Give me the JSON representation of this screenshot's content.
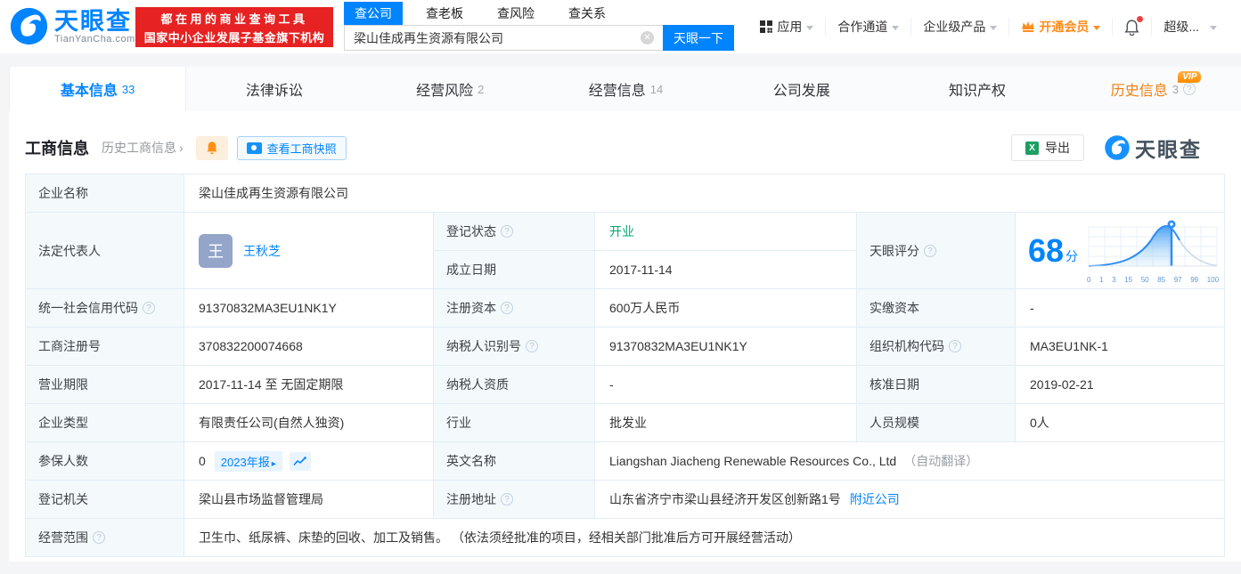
{
  "brand": {
    "name": "天眼查",
    "domain": "TianYanCha.com",
    "primary_color": "#0084ff",
    "promo_line1": "都在用的商业查询工具",
    "promo_line2": "国家中小企业发展子基金旗下机构"
  },
  "search": {
    "tabs": [
      {
        "label": "查公司"
      },
      {
        "label": "查老板"
      },
      {
        "label": "查风险"
      },
      {
        "label": "查关系"
      }
    ],
    "value": "梁山佳成再生资源有限公司",
    "button_label": "天眼一下"
  },
  "top_nav": {
    "apps": "应用",
    "partner": "合作通道",
    "enterprise": "企业级产品",
    "vip": "开通会员",
    "super": "超级..."
  },
  "page_tabs": [
    {
      "label": "基本信息",
      "count": "33"
    },
    {
      "label": "法律诉讼",
      "count": ""
    },
    {
      "label": "经营风险",
      "count": "2"
    },
    {
      "label": "经营信息",
      "count": "14"
    },
    {
      "label": "公司发展",
      "count": ""
    },
    {
      "label": "知识产权",
      "count": ""
    },
    {
      "label": "历史信息",
      "count": "3",
      "vip_badge": "VIP"
    }
  ],
  "section": {
    "title": "工商信息",
    "history_link": "历史工商信息",
    "snapshot_button": "查看工商快照",
    "export_button": "导出",
    "watermark_brand": "天眼查"
  },
  "table": {
    "company_name": {
      "label": "企业名称",
      "value": "梁山佳成再生资源有限公司"
    },
    "legal_rep": {
      "label": "法定代表人",
      "avatar_char": "王",
      "name": "王秋芝"
    },
    "reg_status": {
      "label": "登记状态",
      "value": "开业",
      "color": "#00a870"
    },
    "est_date": {
      "label": "成立日期",
      "value": "2017-11-14"
    },
    "score": {
      "label": "天眼评分",
      "value": "68",
      "unit": "分"
    },
    "credit_code": {
      "label": "统一社会信用代码",
      "value": "91370832MA3EU1NK1Y"
    },
    "reg_capital": {
      "label": "注册资本",
      "value": "600万人民币"
    },
    "paid_capital": {
      "label": "实缴资本",
      "value": "-"
    },
    "reg_number": {
      "label": "工商注册号",
      "value": "370832200074668"
    },
    "taxpayer_id": {
      "label": "纳税人识别号",
      "value": "91370832MA3EU1NK1Y"
    },
    "org_code": {
      "label": "组织机构代码",
      "value": "MA3EU1NK-1"
    },
    "business_term": {
      "label": "营业期限",
      "value": "2017-11-14 至 无固定期限"
    },
    "taxpayer_quality": {
      "label": "纳税人资质",
      "value": "-"
    },
    "approval_date": {
      "label": "核准日期",
      "value": "2019-02-21"
    },
    "company_type": {
      "label": "企业类型",
      "value": "有限责任公司(自然人独资)"
    },
    "industry": {
      "label": "行业",
      "value": "批发业"
    },
    "staff_size": {
      "label": "人员规模",
      "value": "0人"
    },
    "insured_count": {
      "label": "参保人数",
      "value": "0",
      "report_badge": "2023年报"
    },
    "english_name": {
      "label": "英文名称",
      "value": "Liangshan Jiacheng Renewable Resources Co., Ltd",
      "note": "（自动翻译）"
    },
    "reg_authority": {
      "label": "登记机关",
      "value": "梁山县市场监督管理局"
    },
    "reg_address": {
      "label": "注册地址",
      "value": "山东省济宁市梁山县经济开发区创新路1号",
      "nearby_link": "附近公司"
    },
    "business_scope": {
      "label": "经营范围",
      "value": "卫生巾、纸尿裤、床垫的回收、加工及销售。 （依法须经批准的项目，经相关部门批准后方可开展经营活动）"
    }
  },
  "chart_data": {
    "type": "area",
    "title": "天眼评分",
    "score": 68,
    "x_ticks": [
      "0",
      "1",
      "3",
      "15",
      "50",
      "85",
      "97",
      "99",
      "100"
    ],
    "marker_value": 68,
    "accent": "#0084ff",
    "description": "score distribution bell curve, filled blue up to marker at score 68"
  }
}
